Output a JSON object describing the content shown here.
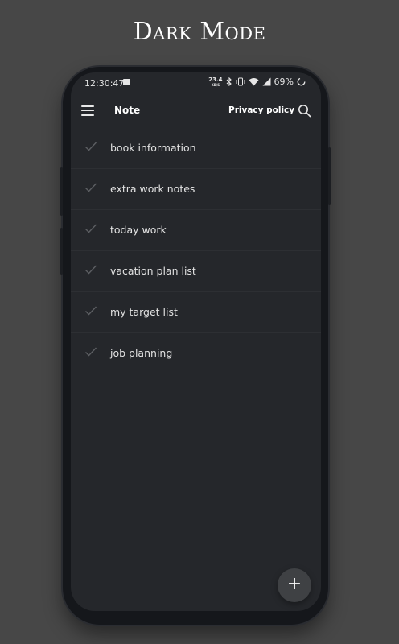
{
  "promo": {
    "title": "Dark Mode"
  },
  "status_bar": {
    "time": "12:30:47",
    "net_speed_value": "23.4",
    "net_speed_unit": "KB/S",
    "battery": "69%"
  },
  "app_bar": {
    "title": "Note",
    "privacy_label": "Privacy policy"
  },
  "notes": [
    {
      "label": "book information"
    },
    {
      "label": "extra work notes"
    },
    {
      "label": "today work"
    },
    {
      "label": "vacation plan list"
    },
    {
      "label": "my target list"
    },
    {
      "label": "job planning"
    }
  ],
  "fab": {
    "label": "+"
  },
  "colors": {
    "background": "#474747",
    "screen": "#25272b",
    "fab": "#3f4144"
  }
}
